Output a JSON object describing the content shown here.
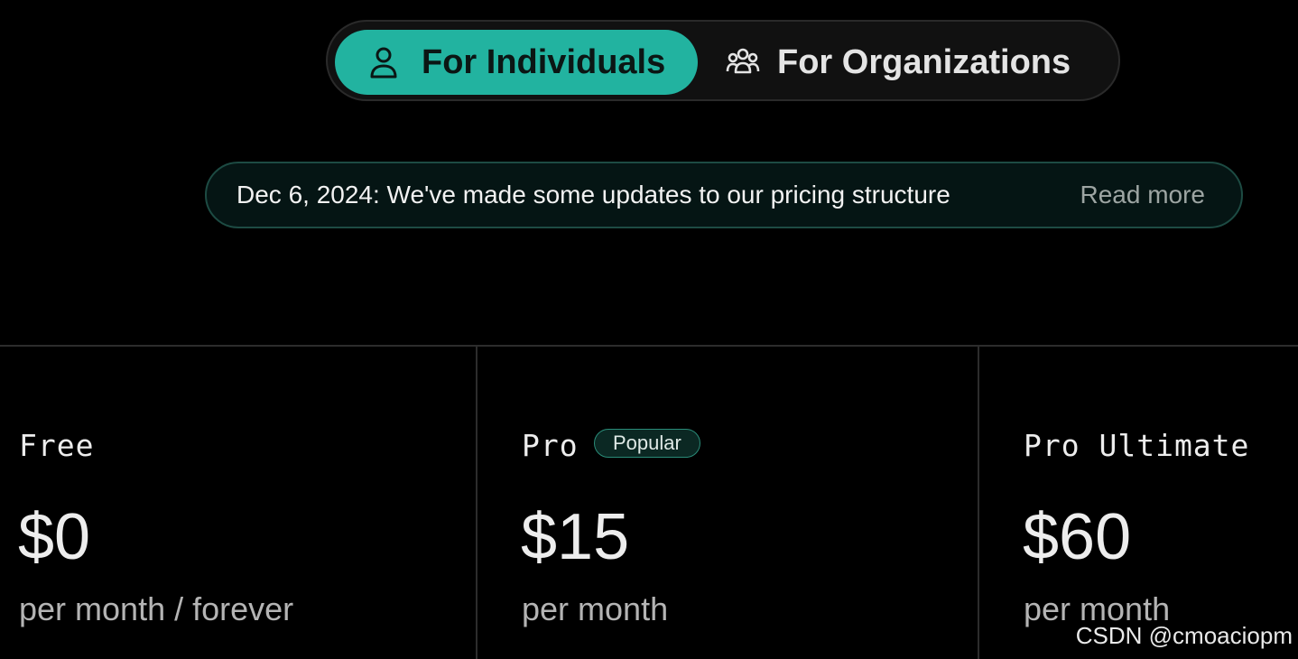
{
  "audience_toggle": {
    "options": [
      {
        "label": "For Individuals",
        "icon": "user-icon",
        "active": true
      },
      {
        "label": "For Organizations",
        "icon": "users-icon",
        "active": false
      }
    ]
  },
  "announcement": {
    "text": "Dec 6, 2024: We've made some updates to our pricing structure",
    "link_label": "Read more"
  },
  "plans": [
    {
      "name": "Free",
      "price": "$0",
      "period": "per month / forever"
    },
    {
      "name": "Pro",
      "badge": "Popular",
      "price": "$15",
      "period": "per month"
    },
    {
      "name": "Pro Ultimate",
      "price": "$60",
      "period": "per month"
    }
  ],
  "watermark": "CSDN @cmoaciopm",
  "colors": {
    "accent": "#22b3a0",
    "background": "#000000",
    "badge_border": "#2a8c79",
    "announcement_border": "#1d4b43"
  }
}
